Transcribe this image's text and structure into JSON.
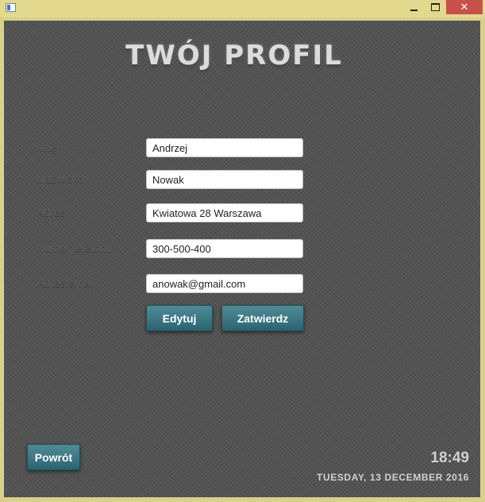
{
  "window": {
    "icons": {
      "app": "app-window-icon",
      "minimize": "minimize-icon",
      "maximize": "maximize-icon",
      "close": "close-icon"
    },
    "close_glyph": "✕"
  },
  "header": {
    "title": "TWÓJ PROFIL"
  },
  "form": {
    "fields": [
      {
        "label": "Imię",
        "value": "Andrzej"
      },
      {
        "label": "Nazwisko",
        "value": "Nowak"
      },
      {
        "label": "Adres",
        "value": "Kwiatowa 28 Warszawa"
      },
      {
        "label": "Numer telefonu",
        "value": "300-500-400"
      },
      {
        "label": "Adres email",
        "value": "anowak@gmail.com"
      }
    ],
    "edit_label": "Edytuj",
    "confirm_label": "Zatwierdz"
  },
  "footer": {
    "back_label": "Powrót",
    "time": "18:49",
    "date": "TUESDAY, 13 DECEMBER 2016"
  },
  "colors": {
    "window_frame": "#d9d089",
    "background": "#505050",
    "button": "#3a7480",
    "close_button": "#c7504b"
  }
}
